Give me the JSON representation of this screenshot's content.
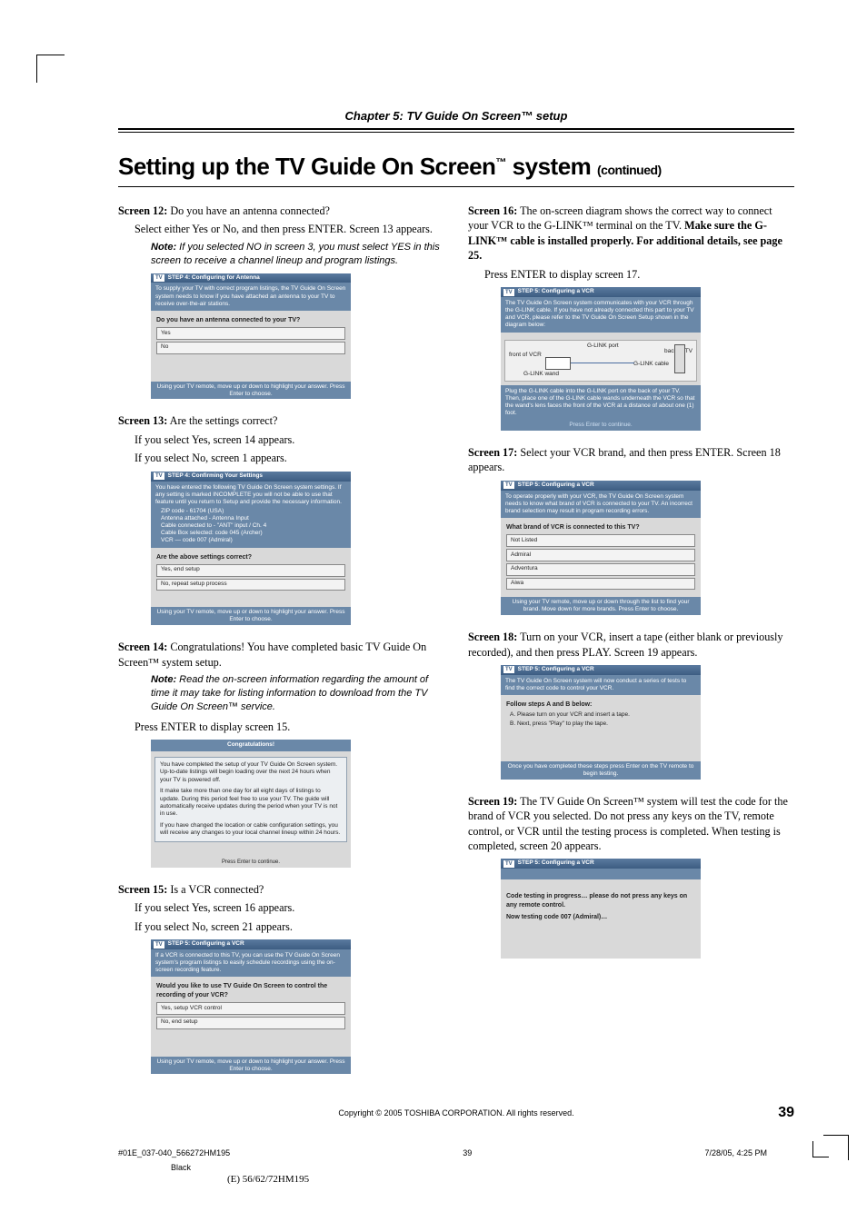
{
  "chapter_header": "Chapter 5: TV Guide On Screen™ setup",
  "title_main": "Setting up the TV Guide On Screen",
  "title_tm": "™",
  "title_system": " system ",
  "title_cont": "(continued)",
  "left": {
    "s12_label": "Screen 12:",
    "s12_q": " Do you have an antenna connected?",
    "s12_body": "Select either Yes or No, and then press ENTER. Screen 13 appears.",
    "s12_note_label": "Note:",
    "s12_note": " If you selected NO in screen 3, you must select YES in this screen to receive a channel lineup and program listings.",
    "ss12": {
      "bar": "STEP 4: Configuring for Antenna",
      "note": "To supply your TV with correct program listings, the TV Guide On Screen system needs to know if you have attached an antenna to your TV to receive over-the-air stations.",
      "q": "Do you have an antenna connected to your TV?",
      "opt1": "Yes",
      "opt2": "No",
      "foot": "Using your TV remote, move up or down to highlight your answer. Press Enter to choose."
    },
    "s13_label": "Screen 13:",
    "s13_q": " Are the settings correct?",
    "s13_yes": "If you select Yes, screen 14 appears.",
    "s13_no": "If you select No, screen 1 appears.",
    "ss13": {
      "bar": "STEP 4: Confirming Your Settings",
      "note": "You have entered the following TV Guide On Screen system settings. If any setting is marked INCOMPLETE you will not be able to use that feature until you return to Setup and provide the necessary information.",
      "lines": "ZIP code - 61704 (USA)\nAntenna attached - Antenna Input\nCable connected to - \"ANT\" input / Ch. 4\nCable Box selected: code 045 (Archer)\nVCR — code 007 (Admiral)",
      "q": "Are the above settings correct?",
      "opt1": "Yes, end setup",
      "opt2": "No, repeat setup process",
      "foot": "Using your TV remote, move up or down to highlight your answer. Press Enter to choose."
    },
    "s14_label": "Screen 14:",
    "s14_q": " Congratulations! You have completed basic TV Guide On Screen™ system setup.",
    "s14_note_label": "Note:",
    "s14_note": " Read the on-screen information regarding the amount of time it may take for listing information to download from the TV Guide On Screen™ service.",
    "s14_press": "Press ENTER to display screen 15.",
    "ss14": {
      "title": "Congratulations!",
      "p1": "You have completed the setup of your TV Guide On Screen system. Up-to-date listings will begin loading over the next 24 hours when your TV is powered off.",
      "p2": "It make take more than one day for all eight days of listings to update. During this period feel free to use your TV. The guide will automatically receive updates during the period when your TV is not in use.",
      "p3": "If you have changed the location or cable configuration settings, you will receive any changes to your local channel lineup within 24 hours.",
      "foot": "Press Enter to continue."
    },
    "s15_label": "Screen 15:",
    "s15_q": " Is a VCR connected?",
    "s15_yes": "If you select Yes, screen 16 appears.",
    "s15_no": "If you select No, screen 21 appears.",
    "ss15": {
      "bar": "STEP 5: Configuring a VCR",
      "note": "If a VCR is connected to this TV, you can use the TV Guide On Screen system's program listings to easily schedule recordings using the on-screen recording feature.",
      "q": "Would you like to use TV Guide On Screen to control the recording of your VCR?",
      "opt1": "Yes, setup VCR control",
      "opt2": "No, end setup",
      "foot": "Using your TV remote, move up or down to highlight your answer. Press Enter to choose."
    }
  },
  "right": {
    "s16_label": "Screen 16:",
    "s16_body1": " The on-screen diagram shows the correct way to connect your VCR to the G-LINK™ terminal on the TV. ",
    "s16_bold": "Make sure the G-LINK™ cable is installed properly. For additional details, see page 25.",
    "s16_body2": "Press ENTER to display screen 17.",
    "ss16": {
      "bar": "STEP 5: Configuring a VCR",
      "note": "The TV Guide On Screen system communicates with your VCR through the G-LINK cable. If you have not already connected this part to your TV and VCR, please refer to the TV Guide On Screen Setup shown in the diagram below:",
      "d_front": "front of VCR",
      "d_glink": "G-LINK port",
      "d_back": "back of TV",
      "d_cable": "G-LINK cable",
      "d_wand": "G-LINK wand",
      "note2": "Plug the G-LINK cable into the G-LINK port on the back of your TV. Then, place one of the G-LINK cable wands underneath the VCR so that the wand's lens faces the front of the VCR at a distance of about one (1) foot.",
      "foot": "Press Enter to continue."
    },
    "s17_label": "Screen 17:",
    "s17_body": " Select your VCR brand, and then press ENTER. Screen 18 appears.",
    "ss17": {
      "bar": "STEP 5: Configuring a VCR",
      "note": "To operate properly with your VCR, the TV Guide On Screen system needs to know what brand of VCR is connected to your TV. An incorrect brand selection may result in program recording errors.",
      "q": "What brand of VCR is connected to this TV?",
      "opt1": "Not Listed",
      "opt2": "Admiral",
      "opt3": "Adventura",
      "opt4": "Aiwa",
      "foot": "Using your TV remote, move up or down through the list to find your brand. Move down for more brands. Press Enter to choose."
    },
    "s18_label": "Screen 18:",
    "s18_body": " Turn on your VCR, insert a tape (either blank or previously recorded), and then press PLAY. Screen 19 appears.",
    "ss18": {
      "bar": "STEP 5: Configuring a VCR",
      "note": "The TV Guide On Screen system will now conduct a series of tests to find the correct code to control your VCR.",
      "q": "Follow steps A and B below:",
      "stepA": "A.   Please turn on your VCR and insert a tape.",
      "stepB": "B.   Next, press \"Play\" to play the tape.",
      "foot": "Once you have completed these steps press Enter on the TV remote to begin testing."
    },
    "s19_label": "Screen 19:",
    "s19_body": " The TV Guide On Screen™ system will test the code for the brand of VCR you selected. Do not press any keys on the TV, remote control, or VCR until the testing process is completed. When testing is completed, screen 20 appears.",
    "ss19": {
      "bar": "STEP 5: Configuring a VCR",
      "line1": "Code testing in progress… please do not press any keys on any remote control.",
      "line2": "Now testing code 007 (Admiral)…"
    }
  },
  "copyright": "Copyright © 2005 TOSHIBA CORPORATION. All rights reserved.",
  "page_number": "39",
  "footer1_left": "#01E_037-040_566272HM195",
  "footer1_mid": "39",
  "footer1_right": "7/28/05, 4:25 PM",
  "footer2": "Black",
  "footer3": "(E) 56/62/72HM195"
}
